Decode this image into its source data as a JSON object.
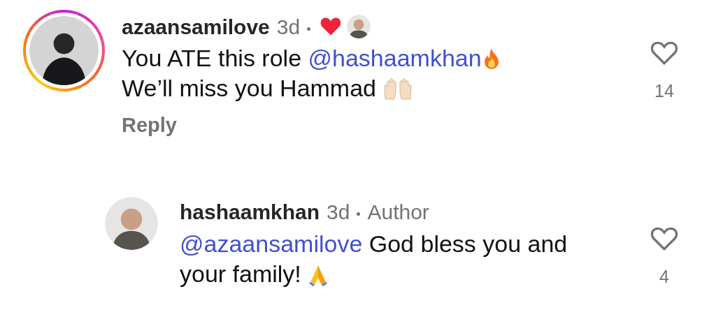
{
  "comments": [
    {
      "username": "azaansamilove",
      "time": "3d",
      "story_ring": true,
      "liked_by_author": true,
      "reply_level": false,
      "lines": [
        [
          {
            "kind": "text",
            "text": "You ATE this role "
          },
          {
            "kind": "mention",
            "text": "@hashaamkhan"
          },
          {
            "kind": "fire"
          }
        ],
        [
          {
            "kind": "text",
            "text": "We’ll miss you Hammad "
          },
          {
            "kind": "raised-hands"
          }
        ]
      ],
      "reply": "Reply",
      "liked": false,
      "likes": "14"
    },
    {
      "username": "hashaamkhan",
      "time": "3d",
      "story_ring": false,
      "liked_by_author": false,
      "author_label": "Author",
      "reply_level": true,
      "lines": [
        [
          {
            "kind": "mention",
            "text": "@azaansamilove"
          },
          {
            "kind": "text",
            "text": " God bless you and"
          }
        ],
        [
          {
            "kind": "text",
            "text": "your family! "
          },
          {
            "kind": "pray"
          }
        ]
      ],
      "liked": false,
      "likes": "4"
    }
  ]
}
